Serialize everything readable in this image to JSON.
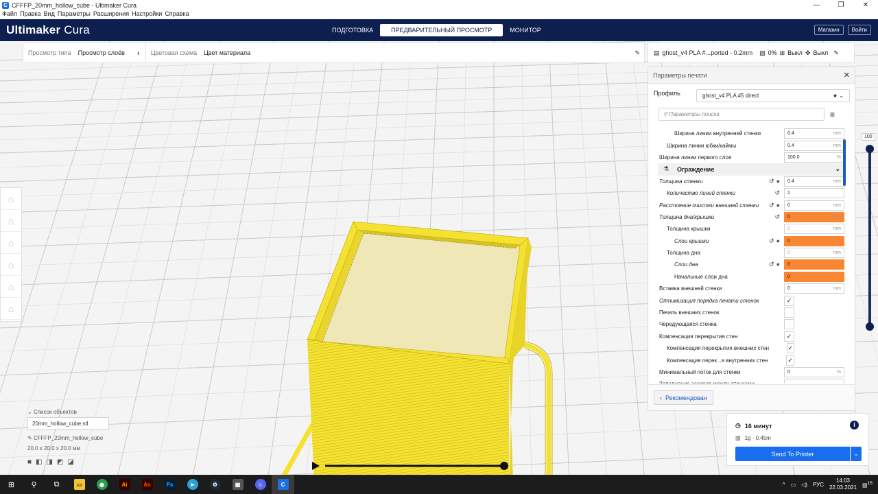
{
  "window": {
    "title": "CFFFP_20mm_hollow_cube - Ultimaker Cura",
    "controls": [
      "—",
      "❐",
      "✕"
    ]
  },
  "menubar": [
    "Файл",
    "Правка",
    "Вид",
    "Параметры",
    "Расширения",
    "Настройки",
    "Справка"
  ],
  "header": {
    "logo_bold": "Ultimaker",
    "logo_light": " Cura",
    "tabs": [
      "ПОДГОТОВКА",
      "ПРЕДВАРИТЕЛЬНЫЙ ПРОСМОТР",
      "МОНИТОР"
    ],
    "active_tab": 1,
    "store": "Магазин",
    "login": "Войти"
  },
  "viewbar": {
    "view_type_label": "Просмотр типа",
    "view_type_value": "Просмотр слоёв",
    "color_scheme_label": "Цветовая схема",
    "color_scheme_value": "Цвет материала"
  },
  "printerbar": {
    "profile": "ghost_v4 PLA #...ported - 0.2mm",
    "infill": "0%",
    "support": "Выкл",
    "adhesion": "Выкл"
  },
  "panel": {
    "title": "Параметры печати",
    "profile_label": "Профиль",
    "profile_value": "ghost_v4 PLA #5 direct",
    "search_placeholder": "Параметры поиска",
    "recommended_button": "Рекомендован",
    "settings": [
      {
        "name": "Ширина линии внутренней стенки",
        "indent": 2,
        "field": "0.4",
        "unit": "mm"
      },
      {
        "name": "Ширина линии юбки/каймы",
        "indent": 1,
        "field": "0.4",
        "unit": "mm"
      },
      {
        "name": "Ширина линии первого слоя",
        "indent": 0,
        "field": "100.0",
        "unit": "%"
      },
      {
        "name": "Ограждение",
        "category": true
      },
      {
        "name": "Толщина стенки",
        "indent": 0,
        "italic": true,
        "reset": true,
        "fx": true,
        "field": "0.4",
        "unit": "mm"
      },
      {
        "name": "Количество линий стенки",
        "indent": 1,
        "italic": true,
        "reset": true,
        "field": "1",
        "unit": ""
      },
      {
        "name": "Расстояние очистки внешней стенки",
        "indent": 0,
        "italic": true,
        "reset": true,
        "fx": true,
        "field": "0",
        "unit": "mm"
      },
      {
        "name": "Толщина дна/крышки",
        "indent": 0,
        "italic": true,
        "reset": true,
        "field": "0",
        "unit": "mm",
        "orange": true
      },
      {
        "name": "Толщина крышки",
        "indent": 1,
        "field": "0",
        "unit": "mm",
        "disabled": true
      },
      {
        "name": "Слои крышки",
        "indent": 2,
        "italic": true,
        "reset": true,
        "fx": true,
        "field": "0",
        "unit": "",
        "orange": true
      },
      {
        "name": "Толщина дна",
        "indent": 1,
        "field": "0",
        "unit": "mm",
        "disabled": true
      },
      {
        "name": "Слои дна",
        "indent": 2,
        "italic": true,
        "reset": true,
        "fx": true,
        "field": "0",
        "unit": "",
        "orange": true
      },
      {
        "name": "Начальные слои дна",
        "indent": 2,
        "field": "0",
        "unit": "",
        "orange": true
      },
      {
        "name": "Вставка внешней стенки",
        "indent": 0,
        "field": "0",
        "unit": "mm"
      },
      {
        "name": "Оптимизация порядка печати стенок",
        "indent": 0,
        "italic": true,
        "check": true
      },
      {
        "name": "Печать внешних стенок",
        "indent": 0,
        "check": false
      },
      {
        "name": "Чередующаяся стенка",
        "indent": 0,
        "check": false
      },
      {
        "name": "Компенсация перекрытия стен",
        "indent": 0,
        "check": true
      },
      {
        "name": "Компенсация перекрытия внешних стен",
        "indent": 1,
        "check": true
      },
      {
        "name": "Компенсация перек...я внутренних стен",
        "indent": 1,
        "check": true
      },
      {
        "name": "Минимальный поток для стенки",
        "indent": 0,
        "field": "0",
        "unit": "%"
      },
      {
        "name": "Заполнение зазоров между стенками",
        "indent": 0,
        "field": "",
        "unit": ""
      }
    ]
  },
  "layer_slider": {
    "max_label": "100"
  },
  "objects": {
    "list_label": "Список объектов",
    "file": "20mm_hollow_cube.stl",
    "project": "CFFFP_20mm_hollow_cube",
    "dims": "20.0 x 20.0 x 20.0 мм"
  },
  "printinfo": {
    "time": "16 минут",
    "material": "1g · 0.45m",
    "send": "Send To Printer"
  },
  "taskbar": {
    "lang": "РУС",
    "time": "14:03",
    "date": "22.03.2021",
    "notif": "15"
  },
  "colors": {
    "header": "#0c1f4f",
    "accent": "#196ef0",
    "model": "#f4e130",
    "warn": "#f98632"
  }
}
